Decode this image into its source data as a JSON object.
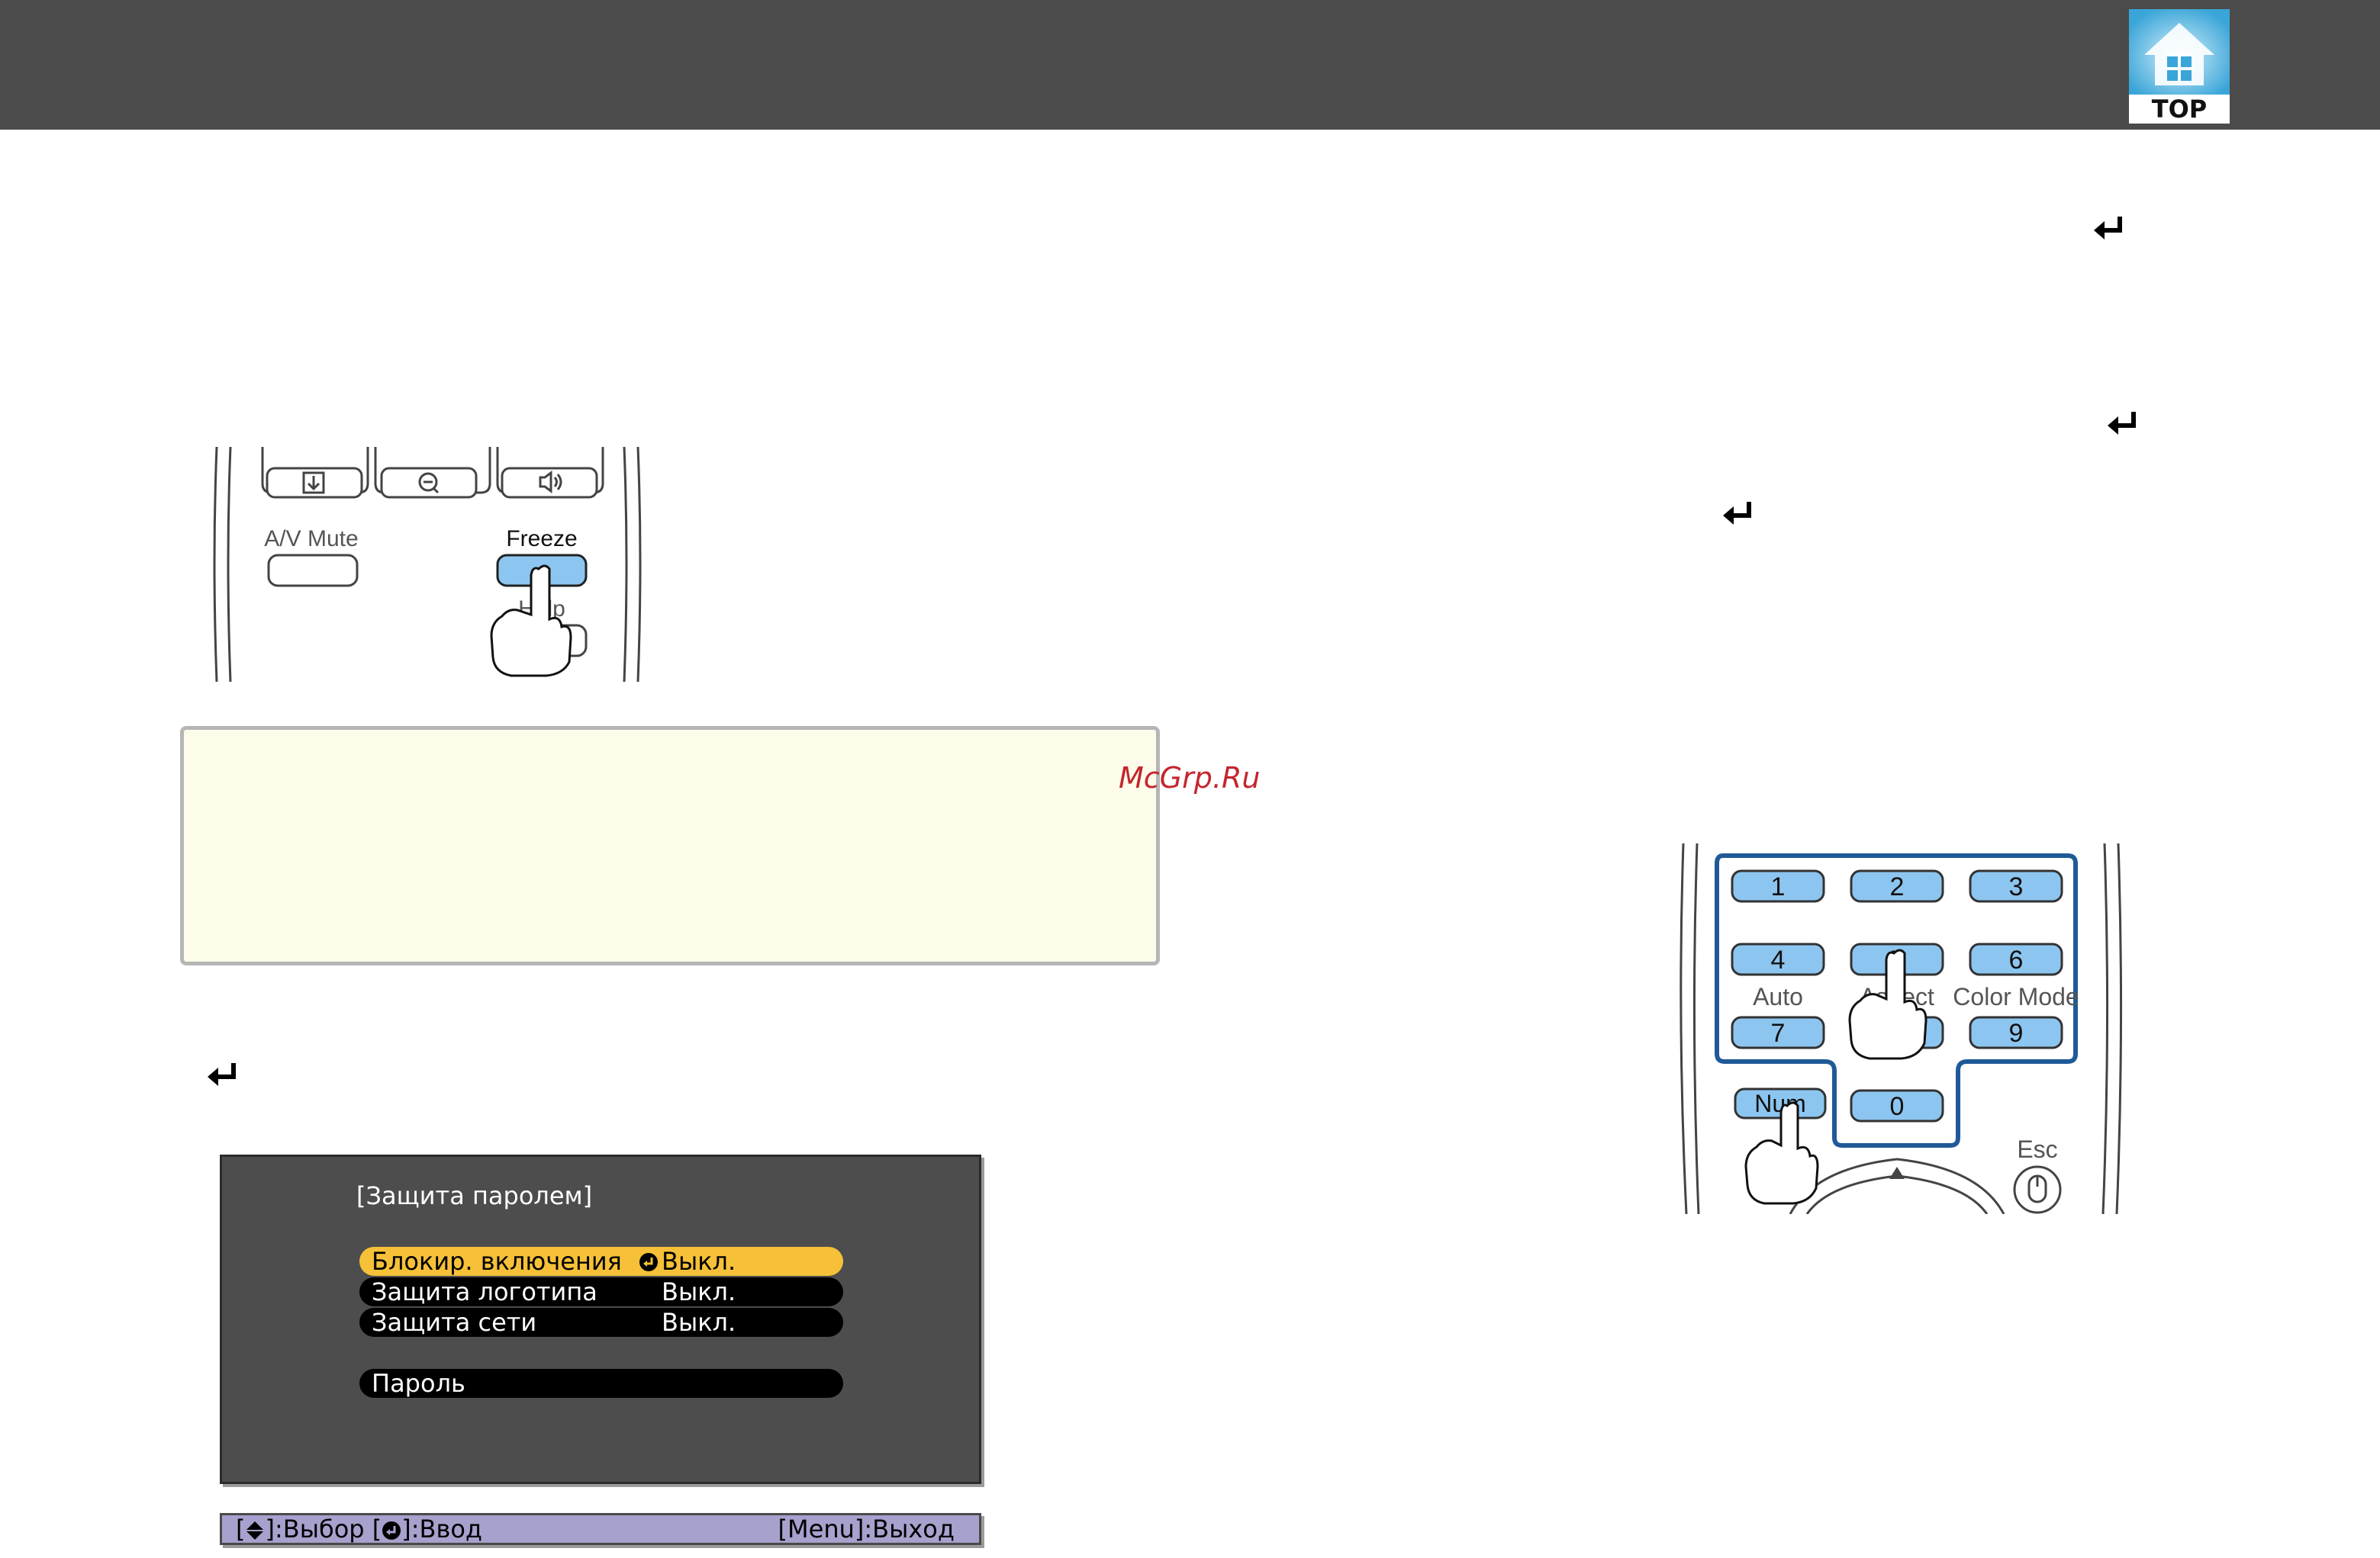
{
  "header": {
    "top_button_label": "TOP"
  },
  "remote_freeze": {
    "av_mute_label": "A/V Mute",
    "freeze_label": "Freeze",
    "help_label_partial": "Help"
  },
  "watermark": "McGrp.Ru",
  "osd": {
    "title": "[Защита паролем]",
    "rows": [
      {
        "label": "Блокир. включения",
        "value": "Выкл."
      },
      {
        "label": "Защита логотипа",
        "value": "Выкл."
      },
      {
        "label": "Защита сети",
        "value": "Выкл."
      },
      {
        "label": "Пароль",
        "value": ""
      }
    ],
    "help_left_select": ":Выбор",
    "help_left_enter": ":Ввод",
    "help_right": "[Menu]:Выход",
    "selected_color": "#f6c138"
  },
  "remote_numeric": {
    "keys": [
      "1",
      "2",
      "3",
      "4",
      "5",
      "6",
      "7",
      "8",
      "9",
      "0"
    ],
    "auto_label": "Auto",
    "aspect_label": "Aspect",
    "color_mode_label": "Color Mode",
    "num_label": "Num",
    "esc_label": "Esc",
    "key_color": "#8cc6f0",
    "frame_color": "#1f5a98"
  }
}
